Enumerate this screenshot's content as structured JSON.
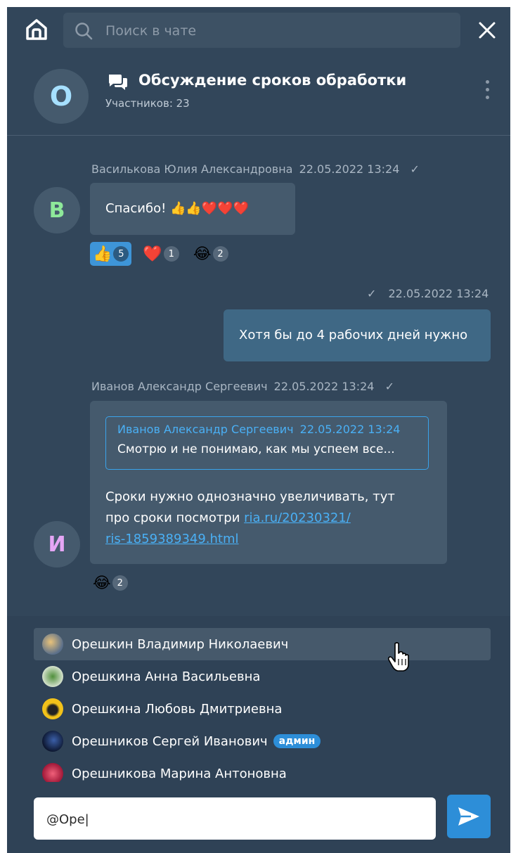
{
  "search": {
    "placeholder": "Поиск в чате"
  },
  "chat": {
    "avatar_letter": "О",
    "title": "Обсуждение сроков обработки",
    "participants": "Участников: 23"
  },
  "messages": [
    {
      "author": "Василькова Юлия Александровна",
      "datetime": "22.05.2022  13:24",
      "avatar_letter": "В",
      "text": "Спасибо! 👍👍❤️❤️❤️",
      "reactions": [
        {
          "emoji": "👍",
          "count": "5",
          "active": true
        },
        {
          "emoji": "❤️",
          "count": "1",
          "active": false
        },
        {
          "emoji": "😂",
          "count": "2",
          "active": false
        }
      ]
    },
    {
      "outgoing": true,
      "datetime": "22.05.2022  13:24",
      "text": "Хотя бы до 4 рабочих дней нужно"
    },
    {
      "author": "Иванов Александр Сергеевич",
      "datetime": "22.05.2022  13:24",
      "avatar_letter": "И",
      "quote": {
        "author": "Иванов Александр Сергеевич",
        "datetime": "22.05.2022  13:24",
        "text": "Смотрю и не понимаю, как мы успеем все..."
      },
      "text_line1": "Сроки нужно однозначно увеличивать, тут",
      "text_line2": "про сроки посмотри ",
      "link_line1": "ria.ru/20230321/",
      "link_line2": "ris-1859389349.html",
      "reactions": [
        {
          "emoji": "😂",
          "count": "2"
        }
      ]
    }
  ],
  "mentions": [
    {
      "name": "Орешкин Владимир Николаевич"
    },
    {
      "name": "Орешкина Анна Васильевна"
    },
    {
      "name": "Орешкина Любовь Дмитриевна"
    },
    {
      "name": "Орешников Сергей Иванович",
      "badge": "админ"
    },
    {
      "name": "Орешникова Марина Антоновна"
    }
  ],
  "composer": {
    "value": "@Оре|"
  },
  "colors": {
    "background": "#32465a",
    "accent": "#2d8ed8",
    "link": "#4ab0f5"
  }
}
